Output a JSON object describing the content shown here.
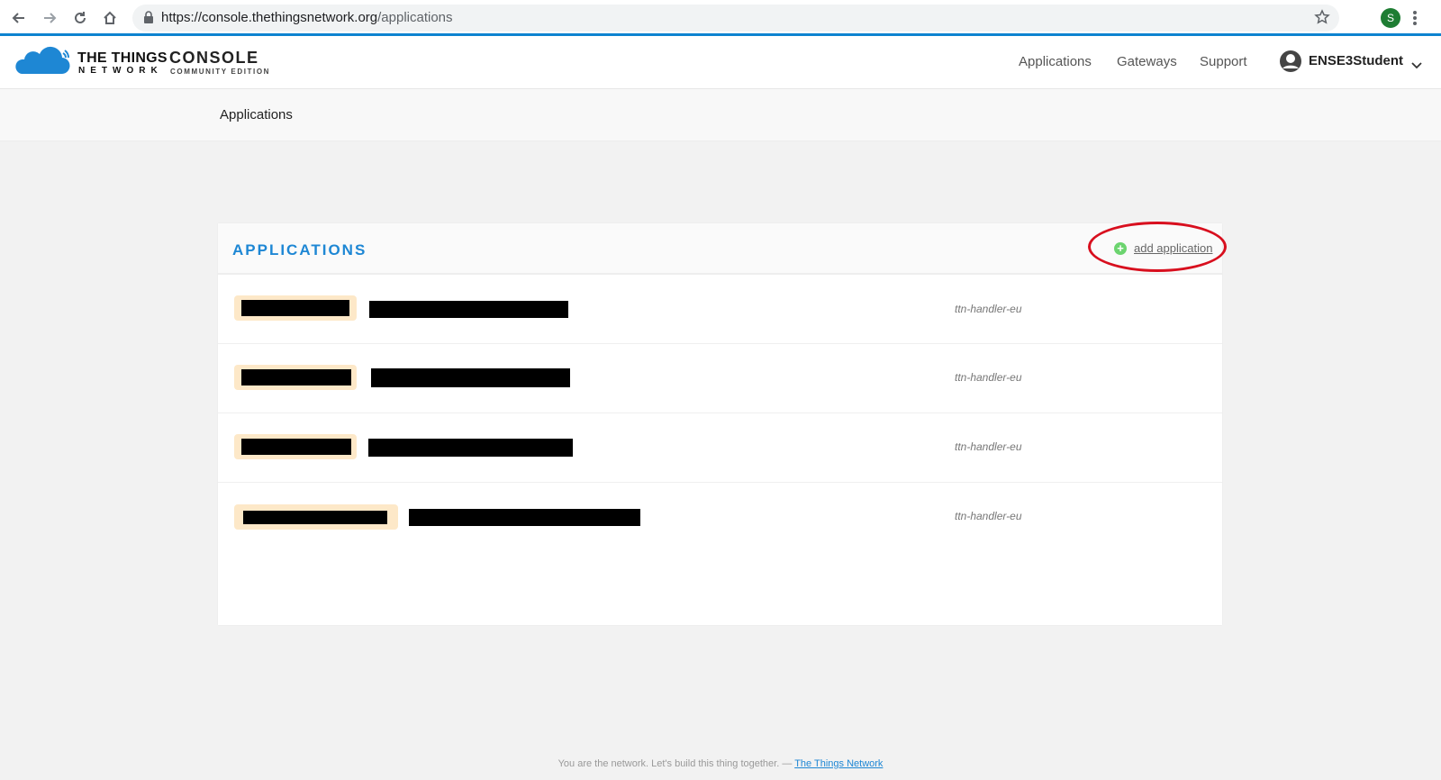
{
  "browser": {
    "url_host": "https://console.thethingsnetwork.org",
    "url_path": "/applications",
    "profile_initial": "S"
  },
  "header": {
    "brand_line1": "THE THINGS",
    "brand_line2": "NETWORK",
    "console_title": "CONSOLE",
    "console_subtitle": "COMMUNITY EDITION",
    "nav": [
      "Applications",
      "Gateways",
      "Support"
    ],
    "username": "ENSE3Student"
  },
  "breadcrumb": "Applications",
  "card": {
    "title": "APPLICATIONS",
    "add_label": "add application",
    "rows": [
      {
        "handler": "ttn-handler-eu"
      },
      {
        "handler": "ttn-handler-eu"
      },
      {
        "handler": "ttn-handler-eu"
      },
      {
        "handler": "ttn-handler-eu"
      }
    ]
  },
  "footer": {
    "text": "You are the network. Let's build this thing together. — ",
    "link": "The Things Network"
  },
  "colors": {
    "accent": "#1e87d4",
    "highlight": "#d80f1e",
    "add_icon": "#6cd46f"
  }
}
